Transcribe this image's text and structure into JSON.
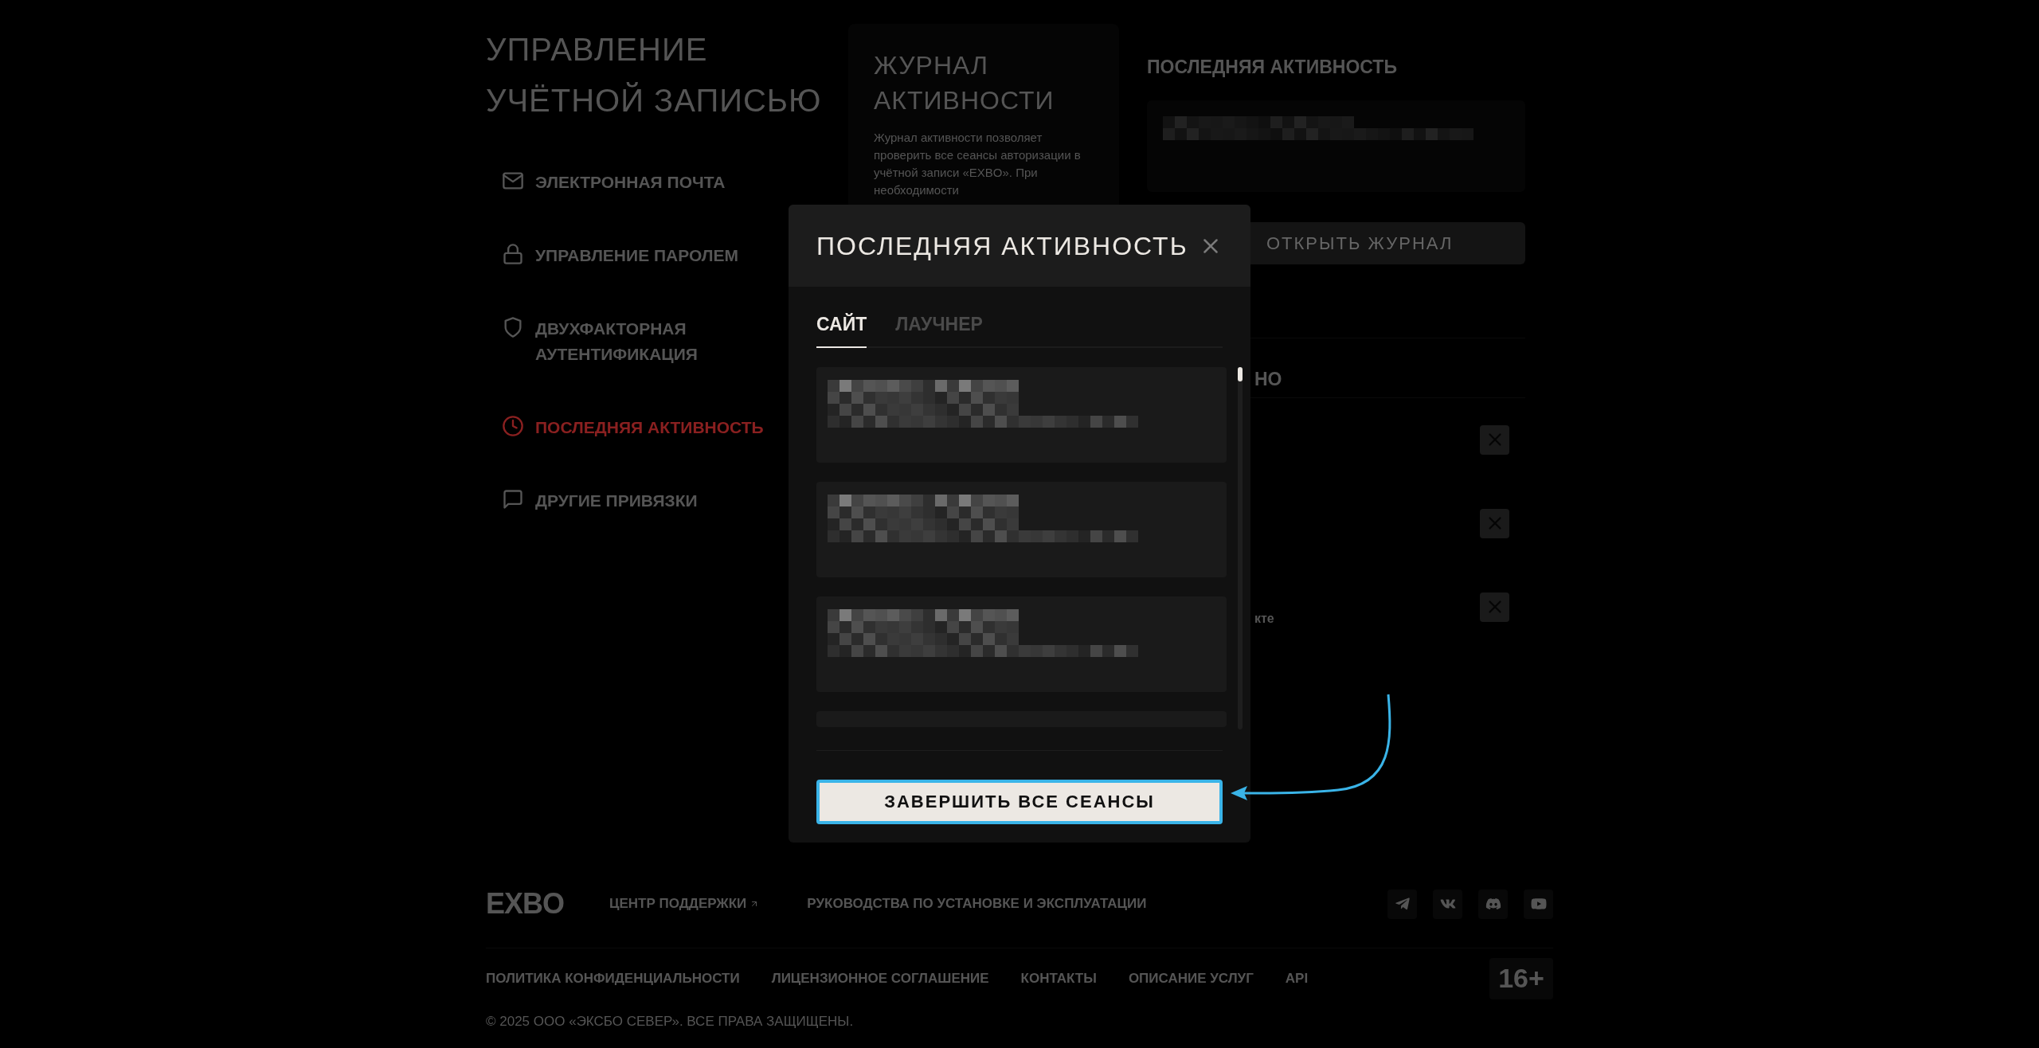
{
  "sidebar": {
    "title": "УПРАВЛЕНИЕ УЧЁТНОЙ ЗАПИСЬЮ",
    "items": [
      {
        "label": "ЭЛЕКТРОННАЯ ПОЧТА",
        "kind": "mail",
        "selected": false
      },
      {
        "label": "УПРАВЛЕНИЕ ПАРОЛЕМ",
        "kind": "lock",
        "selected": false
      },
      {
        "label": "ДВУХФАКТОРНАЯ АУТЕНТИФИКАЦИЯ",
        "kind": "shield",
        "selected": false
      },
      {
        "label": "ПОСЛЕДНЯЯ АКТИВНОСТЬ",
        "kind": "clock",
        "selected": true
      },
      {
        "label": "ДРУГИЕ ПРИВЯЗКИ",
        "kind": "chat",
        "selected": false
      }
    ]
  },
  "journal_card": {
    "title": "ЖУРНАЛ АКТИВНОСТИ",
    "text": "Журнал активности позволяет проверить все сеансы авторизации в учётной записи «EXBO». При необходимости"
  },
  "last_activity": {
    "title": "ПОСЛЕДНЯЯ АКТИВНОСТЬ",
    "button": "ОТКРЫТЬ ЖУРНАЛ"
  },
  "sessions": {
    "title": "НО",
    "rows": [
      {
        "kind": "hidden"
      },
      {
        "kind": "hidden"
      },
      {
        "kind": "text",
        "text": "кте"
      }
    ]
  },
  "modal": {
    "title": "ПОСЛЕДНЯЯ АКТИВНОСТЬ",
    "tabs": [
      {
        "label": "САЙТ",
        "selected": true
      },
      {
        "label": "ЛАУЧНЕР",
        "selected": false
      }
    ],
    "cards": [
      {
        "kind": "full"
      },
      {
        "kind": "full"
      },
      {
        "kind": "full"
      },
      {
        "kind": "cut"
      }
    ],
    "button": "ЗАВЕРШИТЬ ВСЕ СЕАНСЫ"
  },
  "footer": {
    "logo": "EXBO",
    "links_top": [
      {
        "label": "ЦЕНТР ПОДДЕРЖКИ",
        "external": true
      },
      {
        "label": "РУКОВОДСТВА ПО УСТАНОВКЕ И ЭКСПЛУАТАЦИИ",
        "external": false
      }
    ],
    "socials": [
      {
        "kind": "telegram"
      },
      {
        "kind": "vk"
      },
      {
        "kind": "discord"
      },
      {
        "kind": "youtube"
      }
    ],
    "links_bottom": [
      "ПОЛИТИКА КОНФИДЕНЦИАЛЬНОСТИ",
      "ЛИЦЕНЗИОННОЕ СОГЛАШЕНИЕ",
      "КОНТАКТЫ",
      "ОПИСАНИЕ УСЛУГ",
      "API"
    ],
    "age_badge": "16+",
    "copyright": "© 2025 ООО «ЭКСБО СЕВЕР». ВСЕ ПРАВА ЗАЩИЩЕНЫ."
  }
}
